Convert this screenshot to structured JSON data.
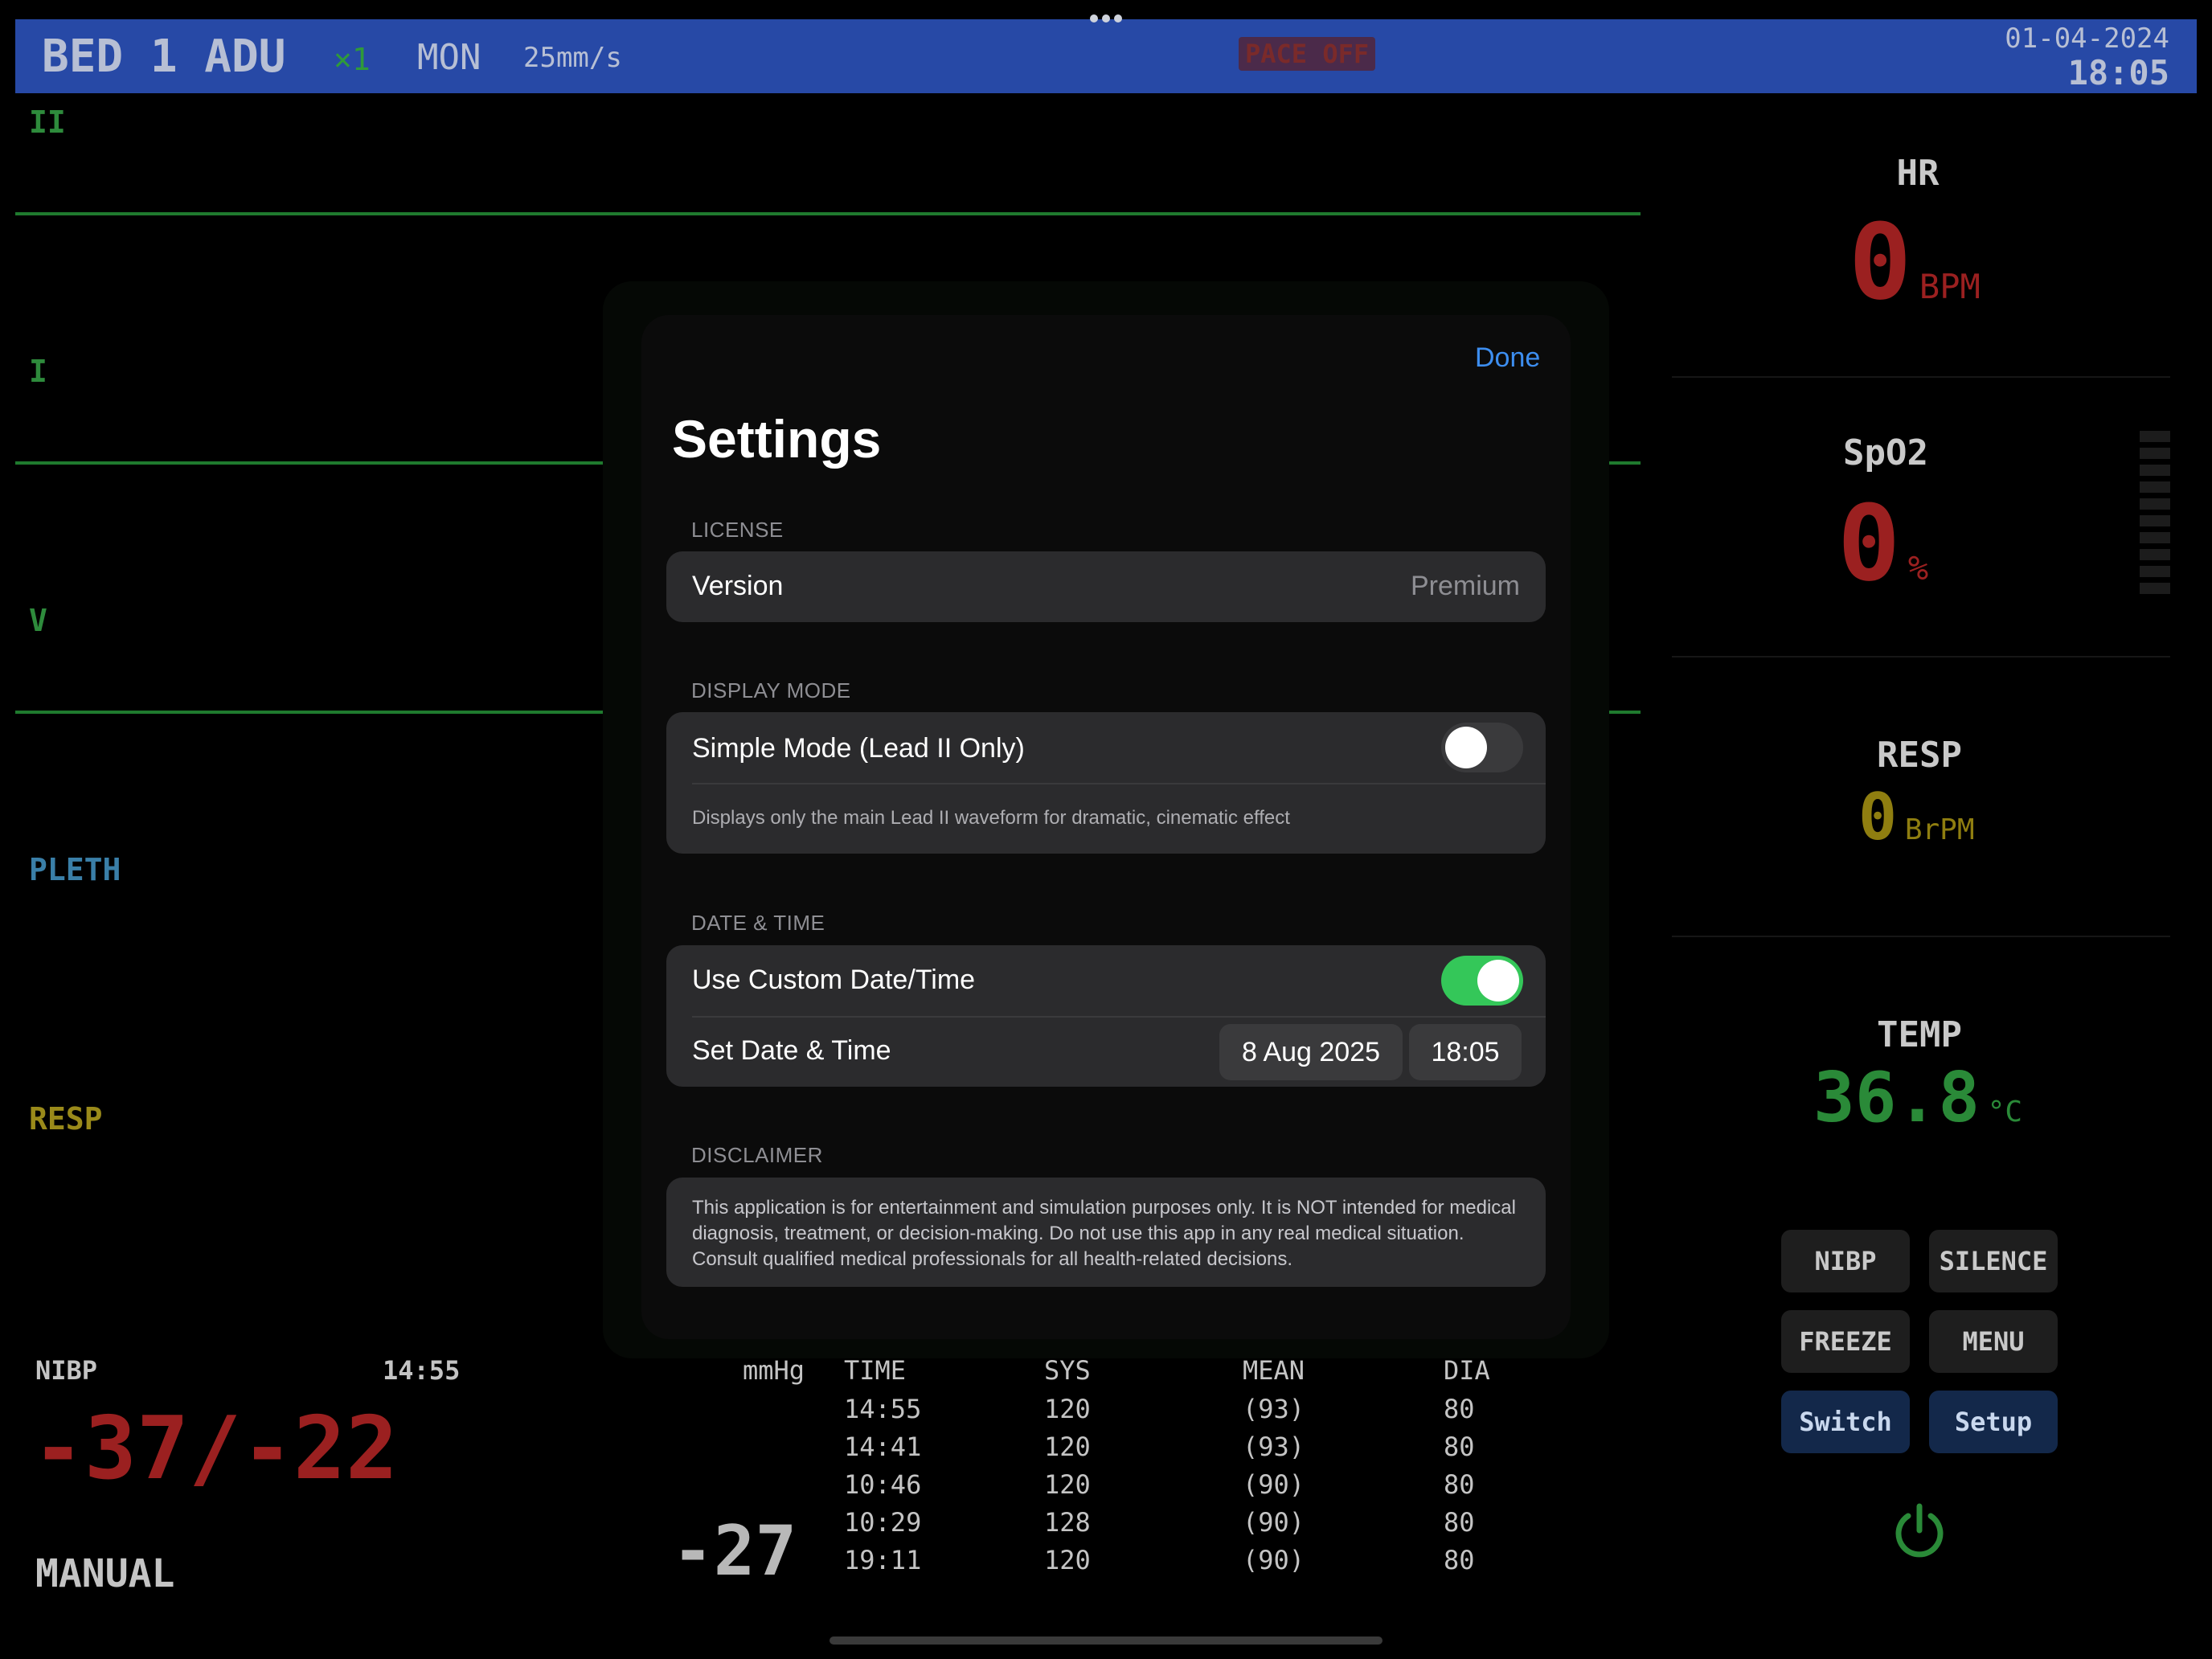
{
  "topbar": {
    "bed": "BED 1 ADU",
    "multiplier": "×1",
    "mode": "MON",
    "speed": "25mm/s",
    "pace": "PACE OFF",
    "date": "01-04-2024",
    "time": "18:05"
  },
  "waveforms": [
    {
      "label": "II",
      "color": "#2e8b3c"
    },
    {
      "label": "I",
      "color": "#2e8b3c"
    },
    {
      "label": "V",
      "color": "#2e8b3c"
    },
    {
      "label": "PLETH",
      "color": "#3a7fa8"
    },
    {
      "label": "RESP",
      "color": "#9a8a1a"
    }
  ],
  "vitals": {
    "hr": {
      "label": "HR",
      "value": "0",
      "unit": "BPM"
    },
    "spo2": {
      "label": "SpO2",
      "value": "0",
      "unit": "%"
    },
    "resp": {
      "label": "RESP",
      "value": "0",
      "unit": "BrPM"
    },
    "temp": {
      "label": "TEMP",
      "value": "36.8",
      "unit": "°C"
    }
  },
  "controls": {
    "nibp": "NIBP",
    "silence": "SILENCE",
    "freeze": "FREEZE",
    "menu": "MENU",
    "switch": "Switch",
    "setup": "Setup"
  },
  "nibp": {
    "label": "NIBP",
    "time": "14:55",
    "value": "-37/-22",
    "mode": "MANUAL",
    "unit": "mmHg",
    "mean": "-27",
    "columns": [
      "TIME",
      "SYS",
      "MEAN",
      "DIA"
    ],
    "history": [
      [
        "14:55",
        "120",
        "(93)",
        "80"
      ],
      [
        "14:41",
        "120",
        "(93)",
        "80"
      ],
      [
        "10:46",
        "120",
        "(90)",
        "80"
      ],
      [
        "10:29",
        "128",
        "(90)",
        "80"
      ],
      [
        "19:11",
        "120",
        "(90)",
        "80"
      ]
    ]
  },
  "settings": {
    "done": "Done",
    "title": "Settings",
    "license_header": "LICENSE",
    "version_label": "Version",
    "version_value": "Premium",
    "display_header": "DISPLAY MODE",
    "simple_mode_label": "Simple Mode (Lead II Only)",
    "simple_mode_on": false,
    "simple_mode_desc": "Displays only the main Lead II waveform for dramatic, cinematic effect",
    "datetime_header": "DATE & TIME",
    "custom_dt_label": "Use Custom Date/Time",
    "custom_dt_on": true,
    "set_dt_label": "Set Date & Time",
    "date_value": "8 Aug 2025",
    "time_value": "18:05",
    "disclaimer_header": "DISCLAIMER",
    "disclaimer_text": "This application is for entertainment and simulation purposes only. It is NOT intended for medical diagnosis, treatment, or decision-making. Do not use this app in any real medical situation. Consult qualified medical professionals for all health-related decisions."
  },
  "colors": {
    "topbar": "#2749a6",
    "alarm_red": "#b3261e",
    "ios_blue": "#3d8ef0",
    "ios_green": "#34c759",
    "ecg_green": "#2e8b3c"
  }
}
